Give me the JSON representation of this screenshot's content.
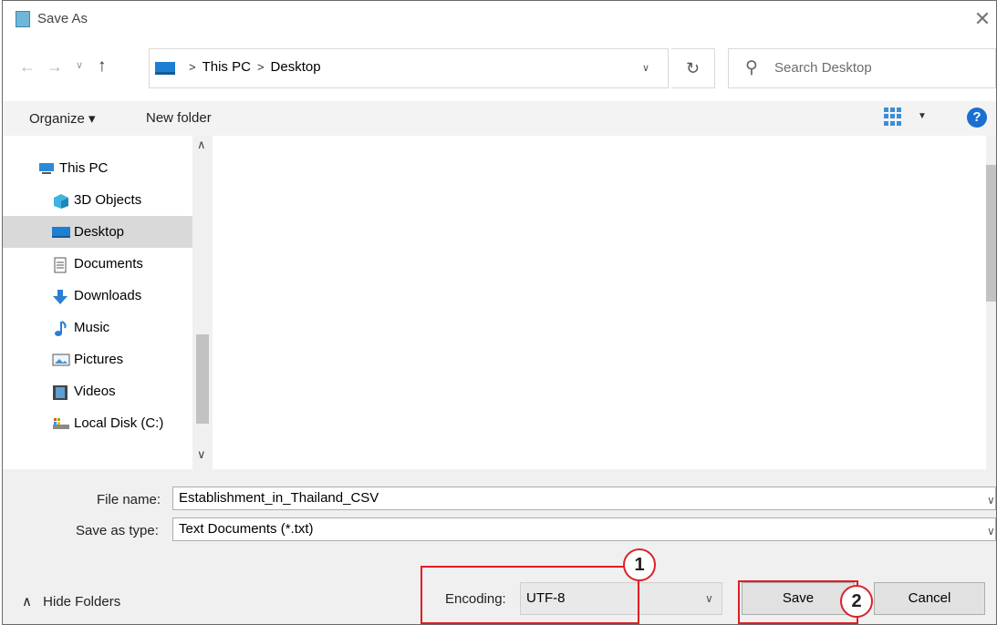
{
  "window": {
    "title": "Save As",
    "close_glyph": "✕"
  },
  "nav": {
    "back": "←",
    "forward": "→",
    "recent": "∨",
    "up": "↑"
  },
  "address": {
    "crumbs": [
      "This PC",
      "Desktop"
    ],
    "dropdown": "∨",
    "refresh": "↻"
  },
  "search": {
    "placeholder": "Search Desktop"
  },
  "toolbar": {
    "organize_label": "Organize ▾",
    "new_folder_label": "New folder",
    "view_drop": "▼",
    "help": "?"
  },
  "sidebar": {
    "scroll_up": "∧",
    "scroll_down": "∨",
    "items": [
      {
        "label": "This PC",
        "icon": "this-pc-icon"
      },
      {
        "label": "3D Objects",
        "icon": "3d-objects-icon"
      },
      {
        "label": "Desktop",
        "icon": "desktop-icon",
        "selected": true
      },
      {
        "label": "Documents",
        "icon": "documents-icon"
      },
      {
        "label": "Downloads",
        "icon": "downloads-icon"
      },
      {
        "label": "Music",
        "icon": "music-icon"
      },
      {
        "label": "Pictures",
        "icon": "pictures-icon"
      },
      {
        "label": "Videos",
        "icon": "videos-icon"
      },
      {
        "label": "Local Disk (C:)",
        "icon": "local-disk-icon"
      }
    ]
  },
  "form": {
    "file_name_label": "File name:",
    "file_name_value": "Establishment_in_Thailand_CSV",
    "save_type_label": "Save as type:",
    "save_type_value": "Text Documents (*.txt)",
    "encoding_label": "Encoding:",
    "encoding_value": "UTF-8",
    "hide_folders_label": "Hide Folders",
    "hide_folders_glyph": "∧",
    "save_label": "Save",
    "cancel_label": "Cancel",
    "drop_glyph": "∨"
  },
  "annotations": {
    "callout_1": "1",
    "callout_2": "2",
    "highlight_color": "#e31b23"
  }
}
